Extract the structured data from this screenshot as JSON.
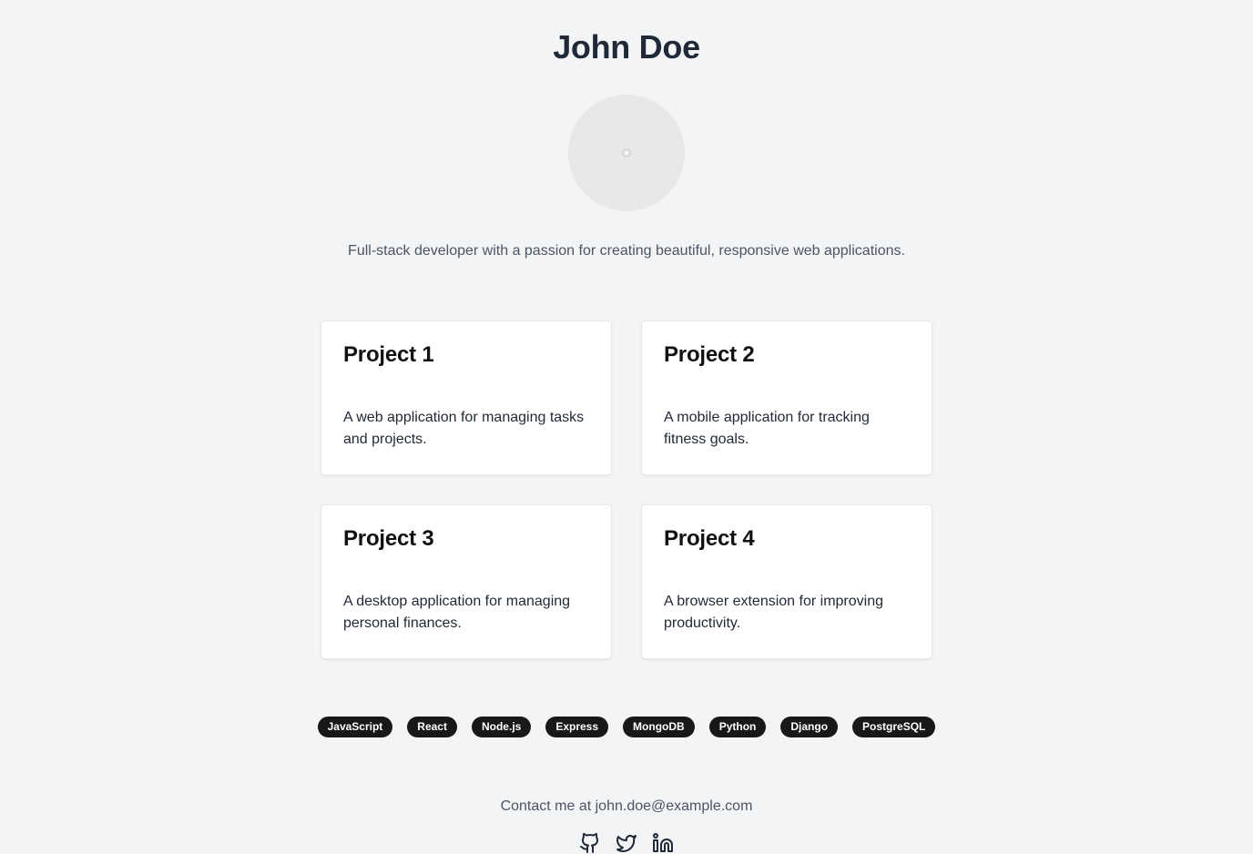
{
  "profile": {
    "name": "John Doe",
    "avatar_icon": "user-avatar-placeholder",
    "bio": "Full-stack developer with a passion for creating beautiful, responsive web applications."
  },
  "projects": [
    {
      "title": "Project 1",
      "description": "A web application for managing tasks and projects."
    },
    {
      "title": "Project 2",
      "description": "A mobile application for tracking fitness goals."
    },
    {
      "title": "Project 3",
      "description": "A desktop application for managing personal finances."
    },
    {
      "title": "Project 4",
      "description": "A browser extension for improving productivity."
    }
  ],
  "skills": [
    "JavaScript",
    "React",
    "Node.js",
    "Express",
    "MongoDB",
    "Python",
    "Django",
    "PostgreSQL"
  ],
  "contact": {
    "text": "Contact me at john.doe@example.com"
  },
  "socials": [
    {
      "icon": "github-icon"
    },
    {
      "icon": "twitter-icon"
    },
    {
      "icon": "linkedin-icon"
    }
  ],
  "colors": {
    "background": "#f3f4f6",
    "card": "#ffffff",
    "badge": "#18181b",
    "muted_text": "#4b5563"
  }
}
